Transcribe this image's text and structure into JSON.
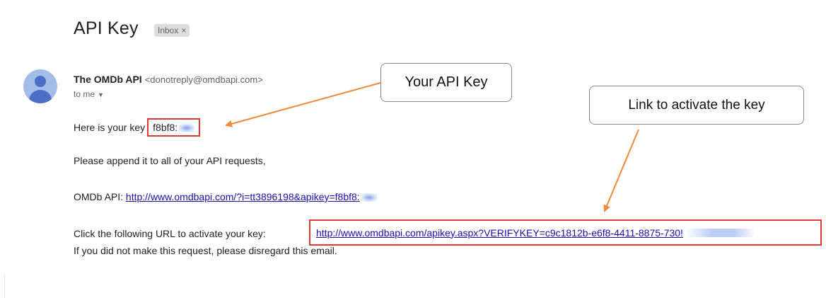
{
  "email": {
    "subject": "API Key",
    "label": "Inbox",
    "label_close": "×",
    "sender_name": "The OMDb API",
    "sender_email": "<donotreply@omdbapi.com>",
    "recipient": "to me",
    "line1_prefix": "Here is your key",
    "key_visible": "f8bf8:",
    "line2": "Please append it to all of your API requests,",
    "line3_prefix": "OMDb API:",
    "line3_link": "http://www.omdbapi.com/?i=tt3896198&apikey=f8bf8:",
    "line4_prefix": "Click the following URL to activate your key:",
    "line4_link": "http://www.omdbapi.com/apikey.aspx?VERIFYKEY=c9c1812b-e6f8-4411-8875-730!",
    "line5": "If you did not make this request, please disregard this email."
  },
  "callouts": {
    "api_key": "Your API Key",
    "activate": "Link to activate the key"
  },
  "colors": {
    "highlight": "#e53935",
    "arrow": "#ee8a3a",
    "link": "#1a0dab"
  }
}
